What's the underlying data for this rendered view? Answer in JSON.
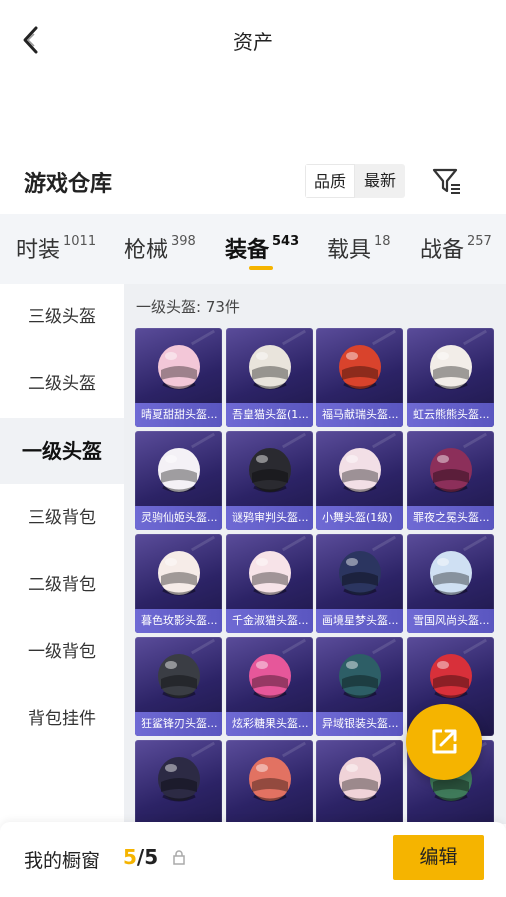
{
  "header": {
    "title": "资产",
    "back_icon": "chevron-left-icon"
  },
  "warehouse": {
    "title": "游戏仓库",
    "sort": {
      "options": [
        "品质",
        "最新"
      ],
      "selected": "品质"
    },
    "filter_icon": "filter-icon"
  },
  "categories": [
    {
      "label": "时装",
      "count": "1011"
    },
    {
      "label": "枪械",
      "count": "398"
    },
    {
      "label": "装备",
      "count": "543",
      "active": true
    },
    {
      "label": "载具",
      "count": "18"
    },
    {
      "label": "战备",
      "count": "257"
    }
  ],
  "subnav": [
    "三级头盔",
    "二级头盔",
    "一级头盔",
    "三级背包",
    "二级背包",
    "一级背包",
    "背包挂件"
  ],
  "subnav_active": "一级头盔",
  "grid": {
    "heading": "一级头盔: 73件",
    "items": [
      {
        "name": "晴夏甜甜头盔...",
        "color": "#f3c7d8"
      },
      {
        "name": "吾皇猫头盔(1...",
        "color": "#e9e4dc"
      },
      {
        "name": "福马献瑞头盔...",
        "color": "#d9432c"
      },
      {
        "name": "虹云熊熊头盔...",
        "color": "#f2ede8"
      },
      {
        "name": "灵驹仙姬头盔...",
        "color": "#f4f1f6"
      },
      {
        "name": "谜鸦审判头盔...",
        "color": "#2a2a30"
      },
      {
        "name": "小舞头盔(1级)",
        "color": "#f2dfe6"
      },
      {
        "name": "罪夜之冕头盔...",
        "color": "#8c2f5a"
      },
      {
        "name": "暮色玫影头盔...",
        "color": "#f6ece8"
      },
      {
        "name": "千金淑猫头盔...",
        "color": "#f7e3e8"
      },
      {
        "name": "画境星梦头盔...",
        "color": "#2b3560"
      },
      {
        "name": "雪国风尚头盔...",
        "color": "#cfe0f3"
      },
      {
        "name": "狂鲨锋刃头盔...",
        "color": "#3a3d44"
      },
      {
        "name": "炫彩糖果头盔...",
        "color": "#e6579a"
      },
      {
        "name": "异域银装头盔...",
        "color": "#2d5e66"
      },
      {
        "name": "",
        "color": "#d8303a"
      },
      {
        "name": "",
        "color": "#2c2a44"
      },
      {
        "name": "",
        "color": "#e27262"
      },
      {
        "name": "",
        "color": "#f0d3d8"
      },
      {
        "name": "",
        "color": "#3f7a5a"
      }
    ]
  },
  "fab_icon": "share-external-icon",
  "bottom": {
    "label": "我的橱窗",
    "current": "5",
    "total": "/5",
    "lock_icon": "lock-icon",
    "edit_label": "编辑"
  },
  "colors": {
    "accent": "#f5b400",
    "card_bg": "#2c2366",
    "caption_bg": "#6f6ad4"
  }
}
